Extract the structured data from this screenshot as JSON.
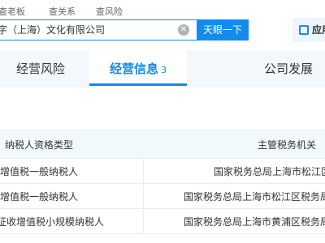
{
  "topnav": {
    "links": [
      "查老板",
      "查关系",
      "查风险"
    ]
  },
  "search": {
    "query": "字（上海）文化有限公司",
    "clear_icon": "close-circle-icon",
    "button_label": "天眼一下"
  },
  "app_button": {
    "label": "应用",
    "icon": "app-grid-icon"
  },
  "tabs": [
    {
      "label": "经营风险",
      "count": ""
    },
    {
      "label": "经营信息",
      "count": "3",
      "active": true
    },
    {
      "label": "公司发展",
      "count": ""
    }
  ],
  "table": {
    "headers": [
      "纳税人资格类型",
      "主管税务机关"
    ],
    "rows": [
      {
        "type": "增值税一般纳税人",
        "authority": "国家税务总局上海市松江区"
      },
      {
        "type": "增值税一般纳税人",
        "authority": "国家税务总局上海市松江区税务局"
      },
      {
        "type": "征收增值税小规模纳税人",
        "authority": "国家税务总局上海市黄浦区税务局"
      }
    ]
  },
  "colors": {
    "accent": "#128bed",
    "tab_bar_bg": "#f3f8fd",
    "header_bg": "#f2f9fc"
  }
}
